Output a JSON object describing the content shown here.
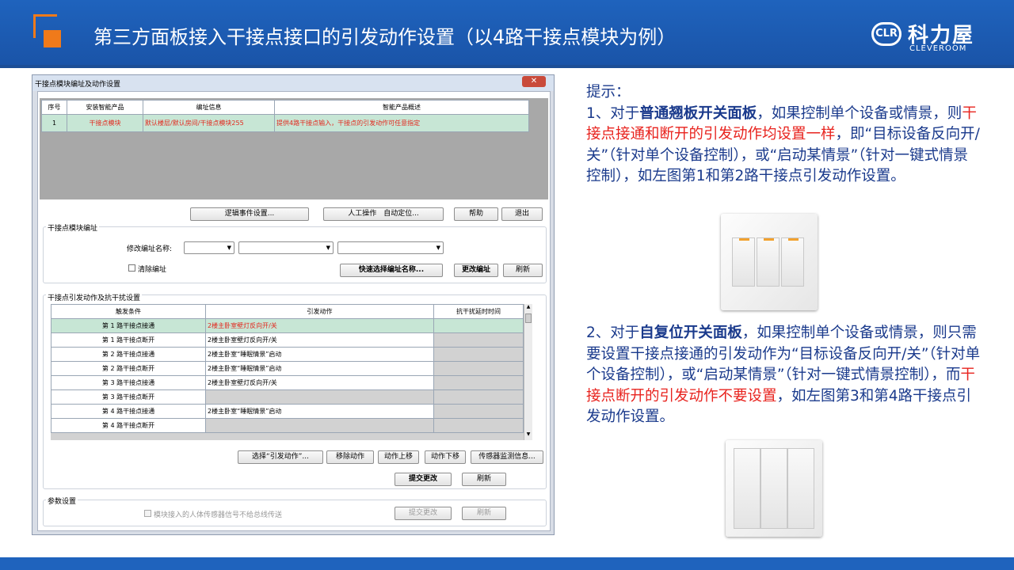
{
  "slide": {
    "title": "第三方面板接入干接点接口的引发动作设置（以4路干接点模块为例）",
    "brand_cn": "科力屋",
    "brand_en": "CLEVEROOM",
    "brand_badge": "CLR"
  },
  "dialog": {
    "title": "干接点模块编址及动作设置",
    "close": "✕",
    "top_table": {
      "headers": [
        "序号",
        "安装智能产品",
        "编址信息",
        "智能产品概述"
      ],
      "row": [
        "1",
        "干接点模块",
        "默认楼层/默认房间/干接点模块255",
        "提供4路干接点输入，干接点的引发动作可任意指定"
      ]
    },
    "top_buttons": [
      "逻辑事件设置...",
      "人工操作　自动定位...",
      "帮助",
      "退出"
    ],
    "addr_group": {
      "title": "干接点模块编址",
      "name_label": "修改编址名称:",
      "clear_label": "清除编址",
      "buttons": [
        "快速选择编址名称...",
        "更改编址",
        "刷新"
      ]
    },
    "action_group": {
      "title": "干接点引发动作及抗干扰设置",
      "headers": [
        "触发条件",
        "引发动作",
        "抗干扰延时时间"
      ],
      "rows": [
        [
          "第 1 路干接点接通",
          "2楼主卧室壁灯反向开/关"
        ],
        [
          "第 1 路干接点断开",
          "2楼主卧室壁灯反向开/关"
        ],
        [
          "第 2 路干接点接通",
          "2楼主卧室“睡眠情景”启动"
        ],
        [
          "第 2 路干接点断开",
          "2楼主卧室“睡眠情景”启动"
        ],
        [
          "第 3 路干接点接通",
          "2楼主卧室壁灯反向开/关"
        ],
        [
          "第 3 路干接点断开",
          ""
        ],
        [
          "第 4 路干接点接通",
          "2楼主卧室“睡眠情景”启动"
        ],
        [
          "第 4 路干接点断开",
          ""
        ]
      ],
      "buttons": [
        "选择“引发动作”...",
        "移除动作",
        "动作上移",
        "动作下移",
        "传感器监测信息..."
      ],
      "submit": "提交更改",
      "refresh": "刷新"
    },
    "param_group": {
      "title": "参数设置",
      "checkbox_label": "模块接入的人体传感器信号不给总线传送",
      "submit": "提交更改",
      "refresh": "刷新"
    }
  },
  "tips": {
    "heading": "提示：",
    "p1_a": "1、对于",
    "p1_b": "普通翘板开关面板",
    "p1_c": "，如果控制单个设备或情景，则",
    "p1_red": "干接点接通和断开的引发动作均设置一样",
    "p1_d": "，即“目标设备反向开/关”（针对单个设备控制），或“启动某情景”（针对一键式情景控制），如左图第1和第2路干接点引发动作设置。",
    "p2_a": "2、对于",
    "p2_b": "自复位开关面板",
    "p2_c": "，如果控制单个设备或情景，则只需要设置干接点接通的引发动作为“目标设备反向开/关”（针对单个设备控制），或“启动某情景”（针对一键式情景控制），而",
    "p2_red": "干接点断开的引发动作不要设置",
    "p2_d": "，如左图第3和第4路干接点引发动作设置。"
  }
}
